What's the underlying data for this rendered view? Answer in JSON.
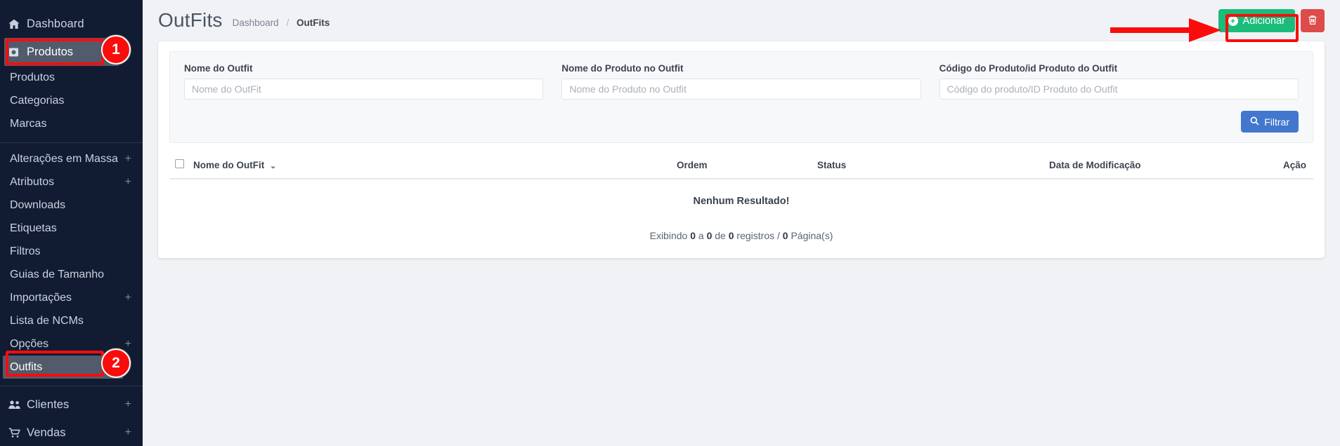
{
  "sidebar": {
    "dashboard": {
      "label": "Dashboard",
      "icon": "home-icon"
    },
    "produtos_group": {
      "label": "Produtos",
      "icon": "box-icon",
      "active": true
    },
    "sub_items": [
      {
        "label": "Produtos"
      },
      {
        "label": "Categorias"
      },
      {
        "label": "Marcas"
      }
    ],
    "group_items": [
      {
        "label": "Alterações em Massa",
        "expander": "+"
      },
      {
        "label": "Atributos",
        "expander": "+"
      },
      {
        "label": "Downloads",
        "expander": ""
      },
      {
        "label": "Etiquetas",
        "expander": ""
      },
      {
        "label": "Filtros",
        "expander": ""
      },
      {
        "label": "Guias de Tamanho",
        "expander": ""
      },
      {
        "label": "Importações",
        "expander": "+"
      },
      {
        "label": "Lista de NCMs",
        "expander": ""
      },
      {
        "label": "Opções",
        "expander": "+"
      },
      {
        "label": "Outfits",
        "expander": "",
        "active": true
      }
    ],
    "bottom_items": [
      {
        "label": "Clientes",
        "icon": "users-icon",
        "expander": "+"
      },
      {
        "label": "Vendas",
        "icon": "cart-icon",
        "expander": "+"
      }
    ]
  },
  "header": {
    "title": "OutFits",
    "breadcrumb": {
      "root": "Dashboard",
      "separator": "/",
      "current": "OutFits"
    },
    "add_button": {
      "label": "Adicionar",
      "icon": "plus-circle-icon",
      "color": "#1abc7b"
    },
    "delete_button": {
      "label": "",
      "icon": "trash-icon",
      "color": "#dd4b4b"
    }
  },
  "filters": {
    "fields": [
      {
        "label": "Nome do Outfit",
        "placeholder": "Nome do OutFit",
        "value": ""
      },
      {
        "label": "Nome do Produto no Outfit",
        "placeholder": "Nome do Produto no Outfit",
        "value": ""
      },
      {
        "label": "Código do Produto/id Produto do Outfit",
        "placeholder": "Código do produto/ID Produto do Outfit",
        "value": ""
      }
    ],
    "submit": {
      "label": "Filtrar",
      "icon": "search-icon",
      "color": "#4277cd"
    }
  },
  "table": {
    "columns": {
      "name": "Nome do OutFit",
      "ordem": "Ordem",
      "status": "Status",
      "data": "Data de Modificação",
      "acao": "Ação"
    },
    "sort_icon": "chevron-down-icon",
    "empty_message": "Nenhum Resultado!",
    "rows": [],
    "pagination": {
      "prefix": "Exibindo",
      "from": "0",
      "middle": "a",
      "to": "0",
      "of": "de",
      "total": "0",
      "records_label": "registros",
      "slash": "/",
      "pages": "0",
      "pages_label": "Página(s)"
    }
  },
  "annotations": {
    "badge_1": "1",
    "badge_2": "2",
    "arrow_color": "#fb0c0c",
    "box_color": "#fb0c0c"
  }
}
